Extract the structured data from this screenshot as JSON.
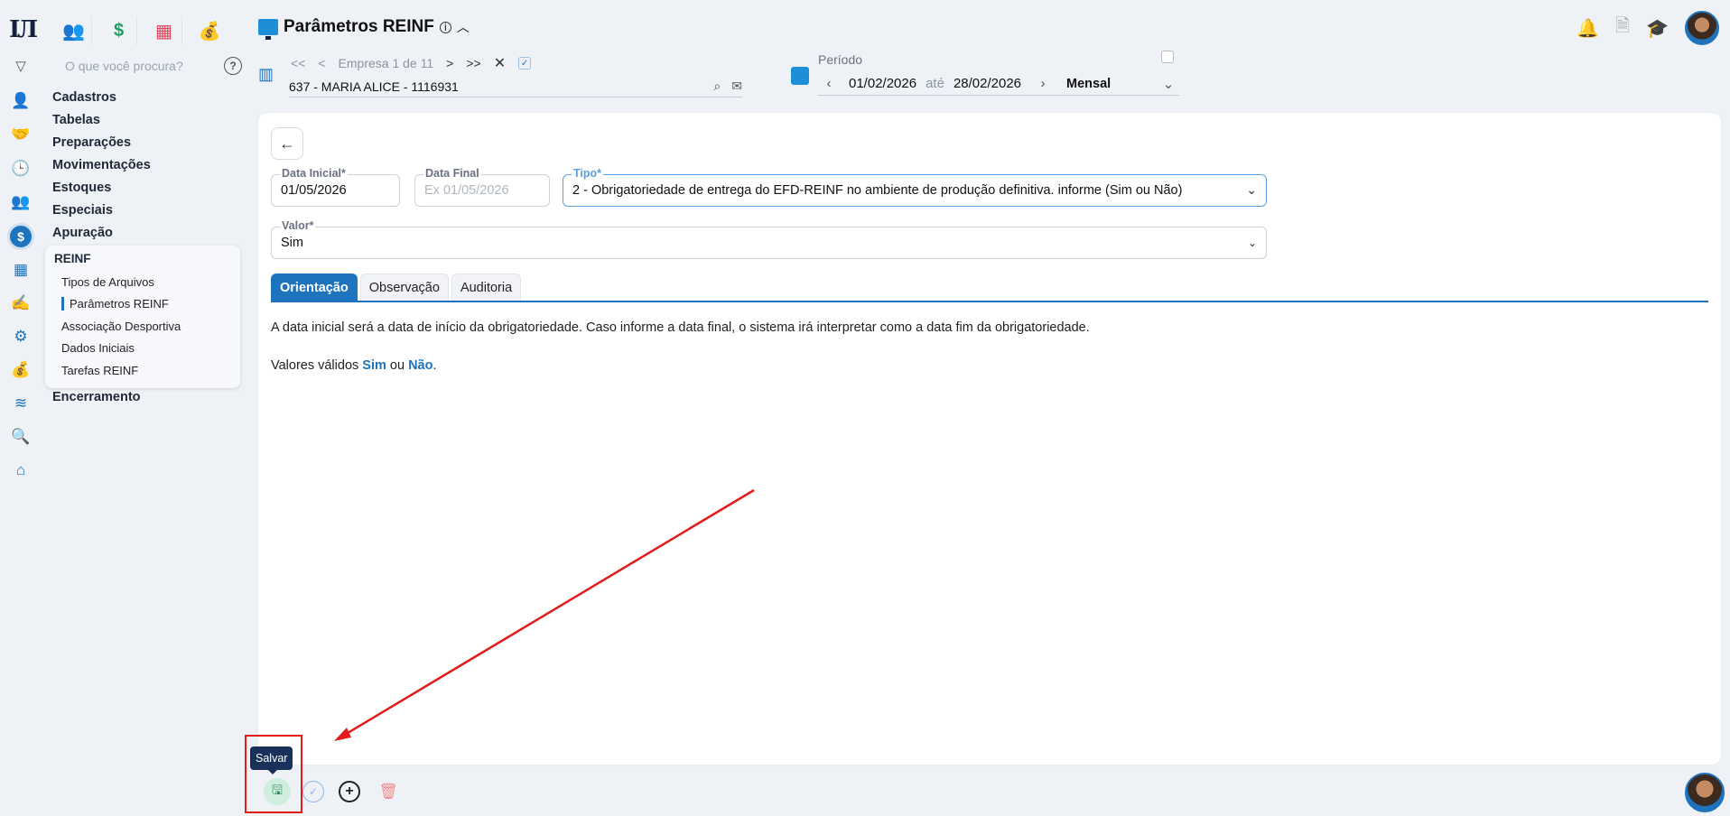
{
  "rail_icons": [
    "users-icon",
    "handshake-icon",
    "clock-icon",
    "people-icon",
    "dollar-icon",
    "calculator-icon",
    "hand-pen-icon",
    "gear-icon",
    "money-bag-icon",
    "layers-icon",
    "magnifier-icon",
    "home-icon"
  ],
  "apps": [
    {
      "icon": "people-group-icon",
      "glyph": "👥",
      "color": "#e0455a"
    },
    {
      "icon": "dollar-icon",
      "glyph": "$",
      "color": "#1aa260"
    },
    {
      "icon": "spreadsheet-icon",
      "glyph": "▦",
      "color": "#e0455a"
    },
    {
      "icon": "money-bag-icon",
      "glyph": "💰",
      "color": "#555555"
    }
  ],
  "search": {
    "placeholder": "O que você procura?"
  },
  "menu": {
    "items": [
      "Cadastros",
      "Tabelas",
      "Preparações",
      "Movimentações",
      "Estoques",
      "Especiais",
      "Apuração"
    ],
    "submenu_head": "REINF",
    "submenu": [
      "Tipos de Arquivos",
      "Parâmetros REINF",
      "Associação Desportiva",
      "Dados Iniciais",
      "Tarefas REINF"
    ],
    "encerramento": "Encerramento"
  },
  "header": {
    "title": "Parâmetros REINF"
  },
  "empresa": {
    "nav_first": "<<",
    "nav_prev": "<",
    "position": "Empresa 1 de 11",
    "nav_next": ">",
    "nav_last": ">>",
    "value": "637 - MARIA ALICE - 1116931"
  },
  "periodo": {
    "label": "Período",
    "start": "01/02/2026",
    "ate": "até",
    "end": "28/02/2026",
    "mode": "Mensal"
  },
  "form": {
    "data_inicial_label": "Data Inicial*",
    "data_inicial": "01/05/2026",
    "data_final_label": "Data Final",
    "data_final_placeholder": "Ex 01/05/2026",
    "tipo_label": "Tipo*",
    "tipo": "2 - Obrigatoriedade de entrega do EFD-REINF no ambiente de produção definitiva. informe (Sim ou Não)",
    "valor_label": "Valor*",
    "valor": "Sim"
  },
  "tabs": [
    "Orientação",
    "Observação",
    "Auditoria"
  ],
  "orientacao": {
    "line1": "A data inicial será a data de início da obrigatoriedade. Caso informe a data final, o sistema irá interpretar como a data fim da obrigatoriedade.",
    "line2_prefix": "Valores válidos ",
    "sim": "Sim",
    "ou": " ou ",
    "nao": "Não",
    "end": "."
  },
  "toolbar": {
    "tooltip": "Salvar"
  },
  "colors": {
    "accent": "#1e73be",
    "annotation": "#e21b1b"
  }
}
